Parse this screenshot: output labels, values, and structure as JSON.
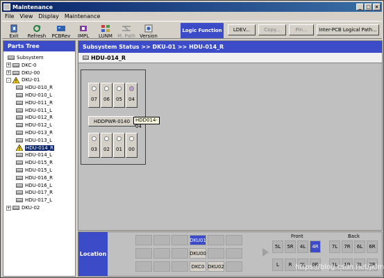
{
  "window": {
    "title": "Maintenance"
  },
  "menu": [
    "File",
    "View",
    "Display",
    "Maintenance"
  ],
  "toolbar": {
    "buttons": [
      {
        "label": "Exit",
        "icon": "exit-icon",
        "enabled": true
      },
      {
        "label": "Refresh",
        "icon": "refresh-icon",
        "enabled": true
      },
      {
        "label": "PCBRev",
        "icon": "pcbrev-icon",
        "enabled": true
      },
      {
        "label": "IMPL",
        "icon": "impl-icon",
        "enabled": true
      },
      {
        "label": "LUNM",
        "icon": "lunm-icon",
        "enabled": true
      },
      {
        "label": "M. Path",
        "icon": "mpath-icon",
        "enabled": false
      },
      {
        "label": "Version",
        "icon": "version-icon",
        "enabled": true
      }
    ],
    "logic_label": "Logic Function",
    "logic_buttons": [
      {
        "label": "LDEV...",
        "enabled": true
      },
      {
        "label": "Copy...",
        "enabled": false
      },
      {
        "label": "Pin...",
        "enabled": false
      },
      {
        "label": "Inter-PCB Logical Path...",
        "enabled": true
      }
    ]
  },
  "parts_tree": {
    "title": "Parts Tree",
    "items": [
      {
        "label": "Subsystem"
      },
      {
        "label": "DKC-0",
        "expander": "+"
      },
      {
        "label": "DKU-00",
        "expander": "+"
      },
      {
        "label": "DKU-01",
        "expander": "-",
        "warning": true
      },
      {
        "label": "HDU-010_R"
      },
      {
        "label": "HDU-010_L"
      },
      {
        "label": "HDU-011_R"
      },
      {
        "label": "HDU-011_L"
      },
      {
        "label": "HDU-012_R"
      },
      {
        "label": "HDU-012_L"
      },
      {
        "label": "HDU-013_R"
      },
      {
        "label": "HDU-013_L"
      },
      {
        "label": "HDU-014_R",
        "warning": true,
        "selected": true
      },
      {
        "label": "HDU-014_L"
      },
      {
        "label": "HDU-015_R"
      },
      {
        "label": "HDU-015_L"
      },
      {
        "label": "HDU-016_R"
      },
      {
        "label": "HDU-016_L"
      },
      {
        "label": "HDU-017_R"
      },
      {
        "label": "HDU-017_L"
      },
      {
        "label": "DKU-02",
        "expander": "+"
      }
    ]
  },
  "status": {
    "breadcrumb": "Subsystem Status >> DKU-01 >> HDU-014_R",
    "title": "HDU-014_R"
  },
  "hdu": {
    "top_slots": [
      {
        "num": "07",
        "led": "#ffffff"
      },
      {
        "num": "06",
        "led": "#ffffff"
      },
      {
        "num": "05",
        "led": "#ffffff"
      },
      {
        "num": "04",
        "led": "#c0a0e0"
      }
    ],
    "bottom_slots": [
      {
        "num": "03",
        "led": "#ffffff"
      },
      {
        "num": "02",
        "led": "#ffffff"
      },
      {
        "num": "01",
        "led": "#ffffff"
      },
      {
        "num": "00",
        "led": "#ffffff"
      }
    ],
    "power_label": "HDDPWR-0140",
    "tooltip": "HDD014-04"
  },
  "location": {
    "label": "Location",
    "grid_labels": {
      "dku01": "DKU01",
      "dku00": "DKU00",
      "dkc0": "DKC0",
      "dku02": "DKU02"
    },
    "front_label": "Front",
    "back_label": "Back",
    "front_top": [
      "5L",
      "5R",
      "4L",
      "4R"
    ],
    "back_top": [
      "7L",
      "7R",
      "6L",
      "6R"
    ],
    "bottom_row": [
      "L",
      "R",
      "0L",
      "0R",
      "1L",
      "1R",
      "2L",
      "2R"
    ],
    "watermark": "https://blog.csdn.net/jklmosaic"
  },
  "colors": {
    "accent": "#3c4bc8",
    "title_start": "#0a246a",
    "title_end": "#3a6ea5"
  }
}
